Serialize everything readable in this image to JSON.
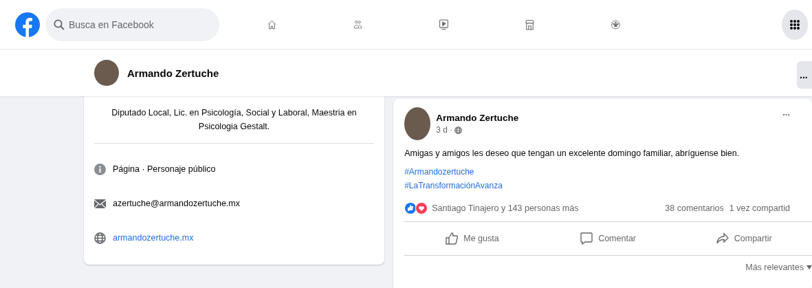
{
  "search": {
    "placeholder": "Busca en Facebook"
  },
  "nav": [
    {
      "kind": "home"
    },
    {
      "kind": "friends"
    },
    {
      "kind": "video"
    },
    {
      "kind": "store"
    },
    {
      "kind": "groups"
    }
  ],
  "page_header": {
    "name": "Armando Zertuche",
    "more": "..."
  },
  "intro": {
    "bio": "Diputado Local, Lic. en Psicología, Social y Laboral, Maestria en Psicologia Gestalt.",
    "items": [
      {
        "kind": "info",
        "text": "Página · Personaje público"
      },
      {
        "kind": "email",
        "text": "azertuche@armandozertuche.mx"
      },
      {
        "kind": "web",
        "text": "armandozertuche.mx"
      }
    ]
  },
  "post": {
    "author": "Armando Zertuche",
    "time": "3 d ·",
    "more": "...",
    "text": "Amigas y amigos les deseo que tengan un excelente domingo familiar, abríguense bien.",
    "hashtags": [
      "#Armandozertuche",
      "#LaTransformaciónAvanza"
    ],
    "reactions": "Santiago Tinajero y 143 personas más",
    "comments": "38 comentarios",
    "shares": "1 vez compartid",
    "actions": [
      {
        "kind": "like",
        "label": "Me gusta"
      },
      {
        "kind": "comment",
        "label": "Comentar"
      },
      {
        "kind": "share",
        "label": "Compartir"
      }
    ],
    "sort": "Más relevantes"
  }
}
